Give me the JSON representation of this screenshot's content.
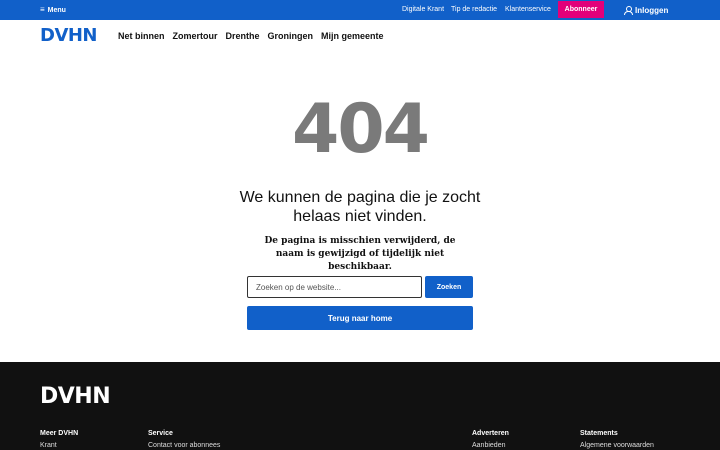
{
  "topbar": {
    "menu_label": "Menu",
    "links": [
      "Digitale Krant",
      "Tip de redactie",
      "Klantenservice"
    ],
    "subscribe_label": "Abonneer",
    "login_label": "Inloggen"
  },
  "header": {
    "logo": "DVHN",
    "nav": [
      "Net binnen",
      "Zomertour",
      "Drenthe",
      "Groningen",
      "Mijn gemeente"
    ]
  },
  "main": {
    "code": "404",
    "title": "We kunnen de pagina die je zocht helaas niet vinden.",
    "subtitle": "De pagina is misschien verwijderd, de naam is gewijzigd of tijdelijk niet beschikbaar.",
    "search_placeholder": "Zoeken op de website...",
    "search_button": "Zoeken",
    "home_button": "Terug naar home"
  },
  "footer": {
    "logo": "DVHN",
    "columns": [
      {
        "heading": "Meer DVHN",
        "link": "Krant"
      },
      {
        "heading": "Service",
        "link": "Contact voor abonnees"
      },
      {
        "heading": "Adverteren",
        "link": "Aanbieden"
      },
      {
        "heading": "Statements",
        "link": "Algemene voorwaarden"
      }
    ]
  },
  "colors": {
    "brand_blue": "#1160c9",
    "subscribe_pink": "#e2007a",
    "footer_bg": "#111111",
    "error_gray": "#7a7a7a"
  }
}
